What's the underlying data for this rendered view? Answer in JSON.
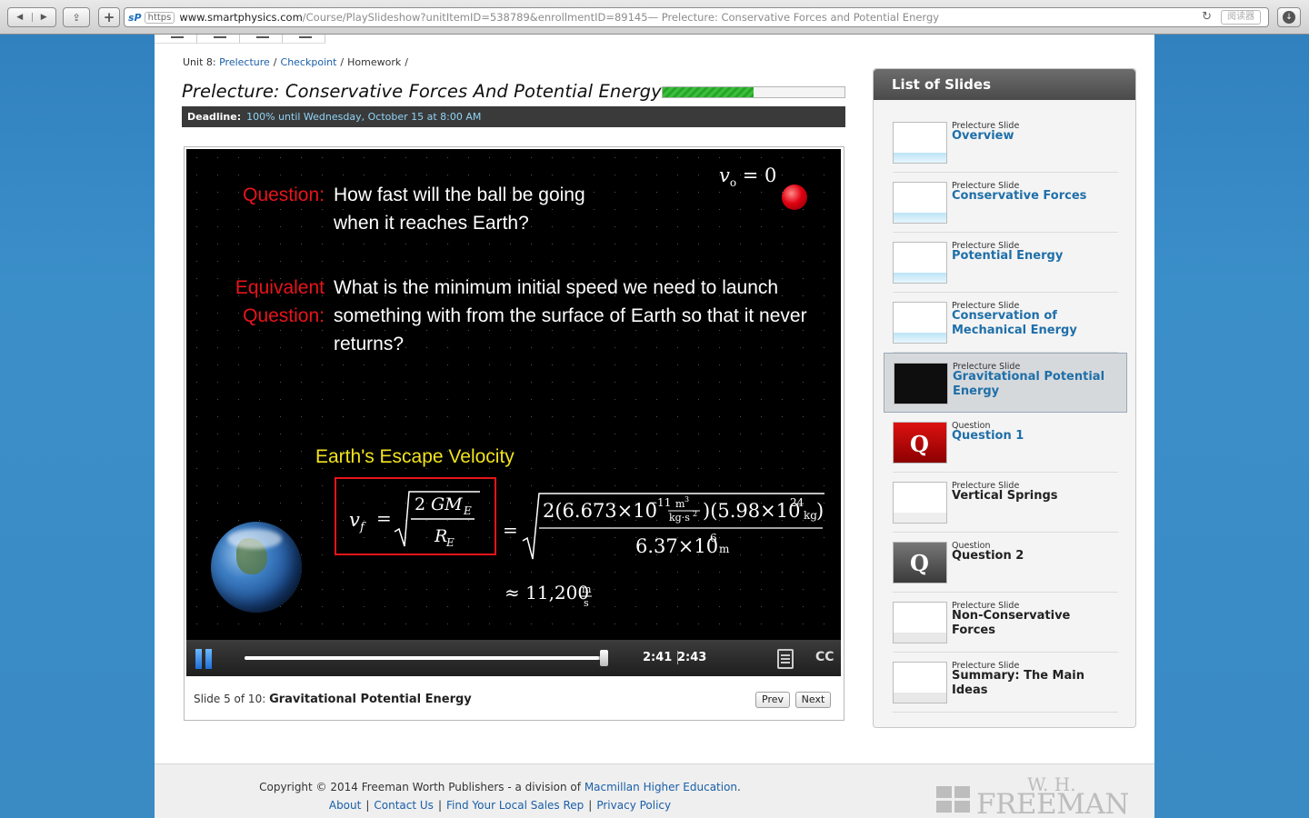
{
  "browser": {
    "scheme_label": "https",
    "url_host": "www.smartphysics.com",
    "url_path": "/Course/PlaySlideshow?unitItemID=538789&enrollmentID=89145",
    "page_title": " — Prelecture: Conservative Forces and Potential Energy",
    "reader_label": "阅读器",
    "site_icon": "sP"
  },
  "breadcrumb": {
    "unit": "Unit 8:",
    "prelecture": "Prelecture",
    "checkpoint": "Checkpoint",
    "homework": "Homework",
    "sep": "/"
  },
  "title": "Prelecture: Conservative Forces And Potential Energy",
  "progress_fraction": 0.5,
  "deadline": {
    "label": "Deadline:",
    "value": "100% until Wednesday, October 15 at 8:00 AM"
  },
  "slide": {
    "q1_label": "Question:",
    "q1_text": "How fast will the ball be going when it reaches Earth?",
    "q2_label": "Equivalent Question:",
    "q2_text": "What is the minimum initial speed we need to launch something with from the surface of Earth so that it never returns?",
    "escape_title": "Earth's Escape Velocity",
    "v0_var": "v",
    "v0_sub": "o",
    "v0_rest": " = 0",
    "result": "≈ 11,200"
  },
  "player": {
    "current_time": "2:41",
    "total_time": "2:43",
    "seek_fraction": 0.985,
    "cc_label": "CC"
  },
  "slide_info": {
    "prefix": "Slide 5 of 10:",
    "name": "Gravitational Potential Energy"
  },
  "nav": {
    "prev": "Prev",
    "next": "Next"
  },
  "sidebar": {
    "heading": "List of Slides",
    "items": [
      {
        "kind": "Prelecture Slide",
        "title": "Overview"
      },
      {
        "kind": "Prelecture Slide",
        "title": "Conservative Forces"
      },
      {
        "kind": "Prelecture Slide",
        "title": "Potential Energy"
      },
      {
        "kind": "Prelecture Slide",
        "title": "Conservation of Mechanical Energy"
      },
      {
        "kind": "Prelecture Slide",
        "title": "Gravitational Potential Energy"
      },
      {
        "kind": "Question",
        "title": "Question 1"
      },
      {
        "kind": "Prelecture Slide",
        "title": "Vertical Springs"
      },
      {
        "kind": "Question",
        "title": "Question 2"
      },
      {
        "kind": "Prelecture Slide",
        "title": "Non-Conservative Forces"
      },
      {
        "kind": "Prelecture Slide",
        "title": "Summary: The Main Ideas"
      }
    ]
  },
  "footer": {
    "copyright_prefix": "Copyright © 2014 Freeman Worth Publishers - a division of ",
    "copyright_link": "Macmillan Higher Education",
    "copyright_suffix": ".",
    "links": [
      "About",
      "Contact Us",
      "Find Your Local Sales Rep",
      "Privacy Policy"
    ],
    "logo_top": "W. H.",
    "logo_bottom": "FREEMAN"
  },
  "colors": {
    "link": "#1a5fa8",
    "accent_red": "#e8141b",
    "accent_yellow": "#f2e31d",
    "deadline_value": "#8fd3f5"
  }
}
